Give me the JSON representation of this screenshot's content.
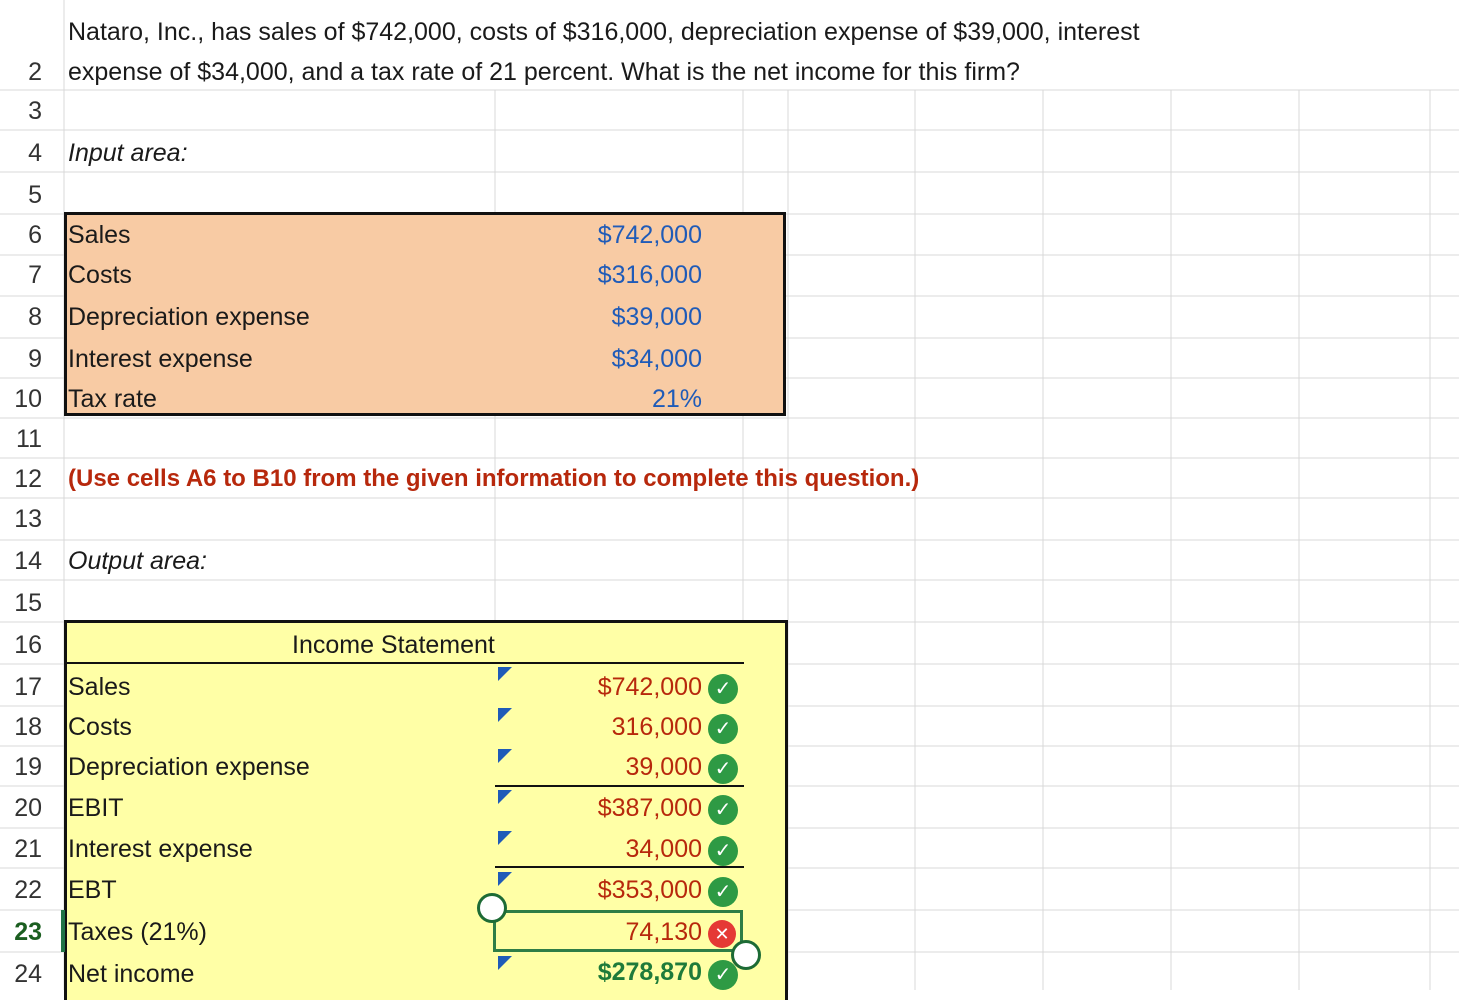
{
  "sheet": {
    "row_numbers": [
      "2",
      "3",
      "4",
      "5",
      "6",
      "7",
      "8",
      "9",
      "10",
      "11",
      "12",
      "13",
      "14",
      "15",
      "16",
      "17",
      "18",
      "19",
      "20",
      "21",
      "22",
      "23",
      "24"
    ],
    "active_row": "23",
    "question_line1": "Nataro, Inc., has sales of $742,000, costs of $316,000, depreciation expense of $39,000, interest",
    "question_line2": "expense of $34,000, and a tax rate of 21 percent. What is the net income for this firm?",
    "input_area_label": "Input area:",
    "output_area_label": "Output area:",
    "instruction": "(Use cells A6 to B10 from the given information to complete this question.)"
  },
  "inputs": [
    {
      "label": "Sales",
      "value": "$742,000"
    },
    {
      "label": "Costs",
      "value": "$316,000"
    },
    {
      "label": "Depreciation expense",
      "value": "$39,000"
    },
    {
      "label": "Interest expense",
      "value": "$34,000"
    },
    {
      "label": "Tax rate",
      "value": "21%"
    }
  ],
  "income_statement": {
    "title": "Income Statement",
    "rows": [
      {
        "label": "Sales",
        "value": "$742,000",
        "status": "correct"
      },
      {
        "label": "Costs",
        "value": "316,000",
        "status": "correct"
      },
      {
        "label": "Depreciation expense",
        "value": "39,000",
        "status": "correct"
      },
      {
        "label": "EBIT",
        "value": "$387,000",
        "status": "correct"
      },
      {
        "label": "Interest expense",
        "value": "34,000",
        "status": "correct"
      },
      {
        "label": "EBT",
        "value": "$353,000",
        "status": "correct"
      },
      {
        "label": "Taxes (21%)",
        "value": "74,130",
        "status": "incorrect"
      },
      {
        "label": "Net income",
        "value": "$278,870",
        "status": "correct"
      }
    ]
  },
  "icons": {
    "correct": "check-circle-icon",
    "incorrect": "x-circle-icon",
    "comment": "cell-comment-indicator-icon"
  },
  "colors": {
    "input_fill": "#f8cba4",
    "output_fill": "#ffffa6",
    "input_value": "#1f5bb8",
    "output_value": "#b7280c",
    "correct": "#2e9a44",
    "incorrect": "#e53935"
  }
}
